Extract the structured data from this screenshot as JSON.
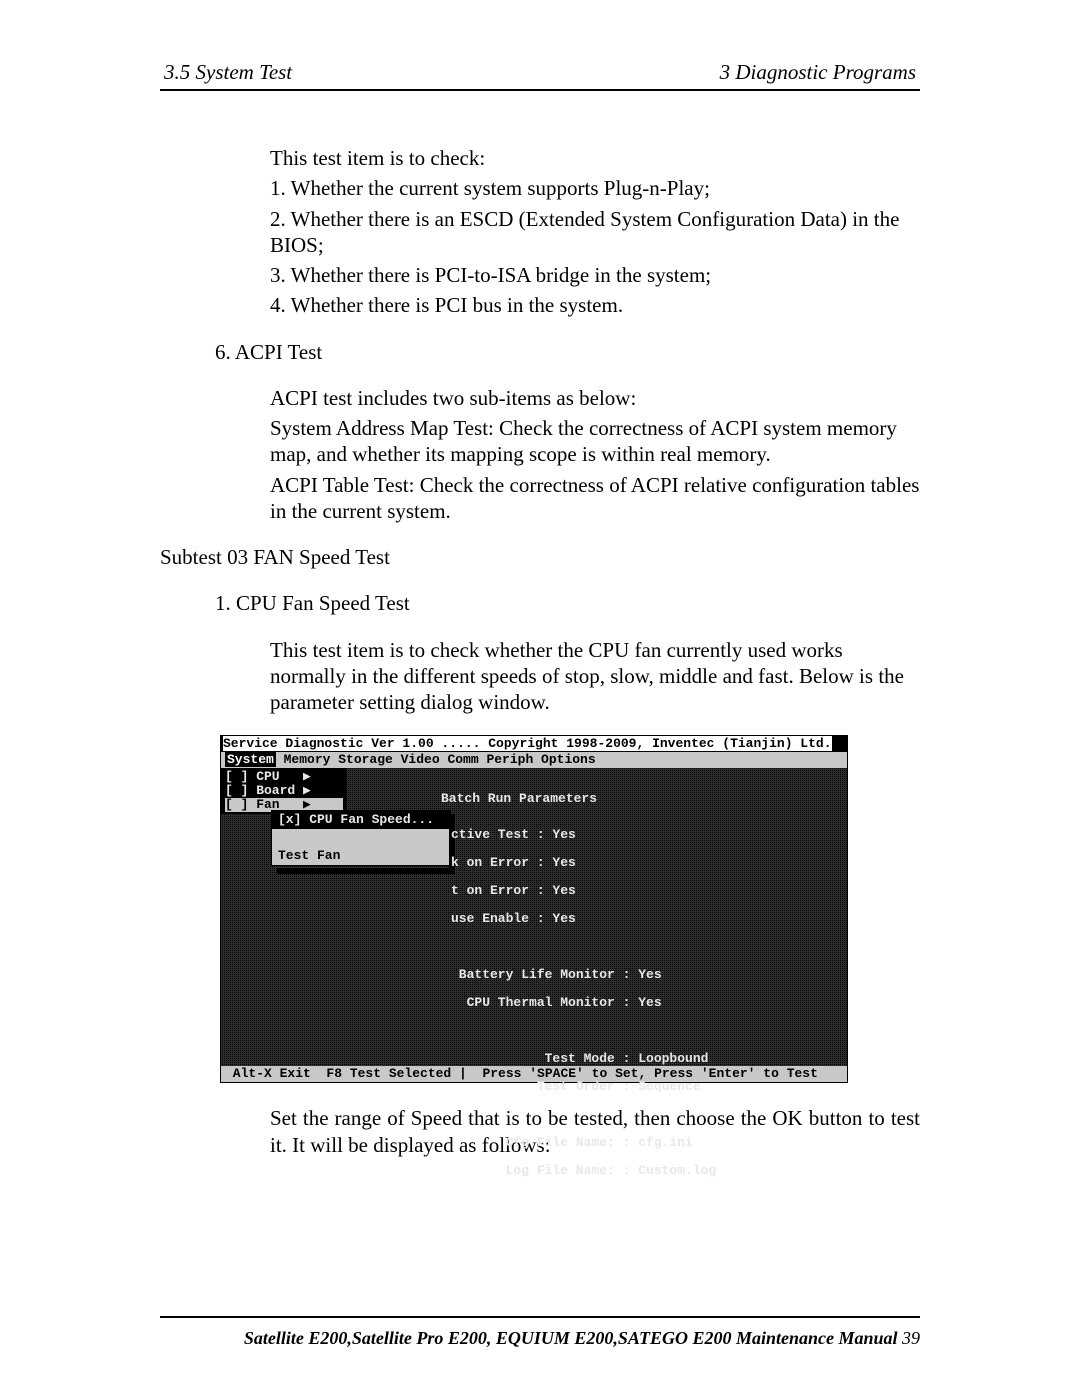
{
  "header": {
    "left": "3.5 System Test",
    "right": "3  Diagnostic Programs"
  },
  "intro": "This test item is to check:",
  "checks": {
    "c1": "1.   Whether the current system supports Plug-n-Play;",
    "c2": "2.   Whether there is an ESCD (Extended System Configuration Data) in the BIOS;",
    "c3": "3.   Whether there is PCI-to-ISA bridge in the system;",
    "c4": "4.   Whether there is PCI bus in the system."
  },
  "acpi": {
    "heading": "6.   ACPI Test",
    "l1": "ACPI test includes two sub-items as below:",
    "l2": "System Address Map Test: Check the correctness of ACPI system memory map, and whether its mapping scope is within real memory.",
    "l3": "ACPI Table Test: Check the correctness of ACPI relative configuration tables in the current system."
  },
  "subtest": "Subtest 03  FAN Speed Test",
  "fan": {
    "heading": "1. CPU Fan Speed Test",
    "body": "This test item is to check whether the CPU fan currently used works normally in the different speeds of stop, slow, middle and fast. Below is the parameter setting dialog window."
  },
  "terminal": {
    "title_a": "Service Diagnostic Ver 1.00 ..... Copyright 1998-2009, Inventec (Tianjin) Ltd.",
    "menubar": {
      "system": "System",
      "rest": "  Memory   Storage   Video   Comm   Periph   Options"
    },
    "left": {
      "r1": "[ ] CPU",
      "r2": "[ ] Board",
      "r3": "[ ] Fan"
    },
    "submenu": {
      "r1": "[x] CPU Fan Speed...",
      "r2": " ",
      "r3": "Test Fan"
    },
    "panel_title": "Batch Run Parameters",
    "panel": {
      "p1": "ctive Test : Yes",
      "p2": "k on Error : Yes",
      "p3": "t on Error : Yes",
      "p4": "use Enable : Yes",
      "p5": "",
      "p6": " Battery Life Monitor : Yes",
      "p7": "  CPU Thermal Monitor : Yes",
      "p8": "",
      "p9": "            Test Mode : Loopbound",
      "p10": "           Test Order : Sequence",
      "p11": "",
      "p12": "       Cfg File Name: : cfg.ini",
      "p13": "       Log File Name: : Custom.log"
    },
    "status": " Alt-X Exit  F8 Test Selected |  Press 'SPACE' to Set, Press 'Enter' to Test"
  },
  "after": "Set the range of Speed that is to be tested, then choose the OK button to test it. It will be displayed as follows:",
  "footer": {
    "book": "Satellite E200,Satellite Pro E200, EQUIUM E200,SATEGO E200 Maintenance Manual",
    "page": " 39"
  }
}
